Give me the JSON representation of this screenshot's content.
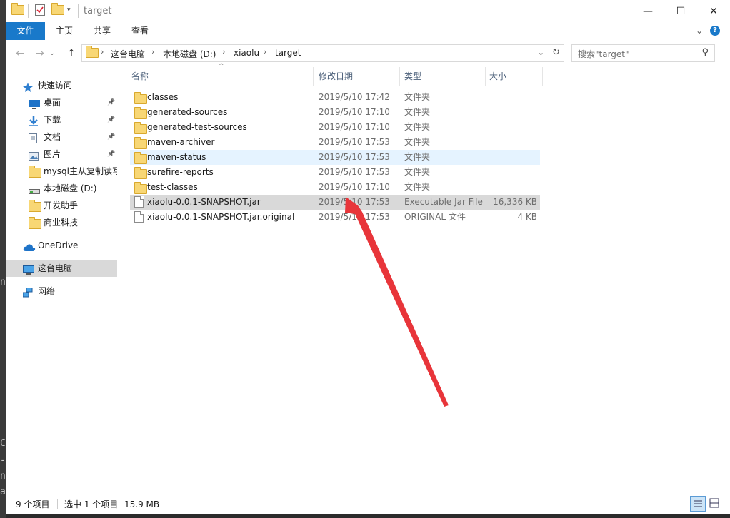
{
  "window": {
    "title": "target",
    "controls": {
      "minimize": "—",
      "maximize": "☐",
      "close": "✕"
    }
  },
  "ribbon": {
    "tabs": [
      "文件",
      "主页",
      "共享",
      "查看"
    ]
  },
  "address": {
    "crumbs": [
      "这台电脑",
      "本地磁盘 (D:)",
      "xiaolu",
      "target"
    ]
  },
  "search": {
    "placeholder": "搜索\"target\""
  },
  "sidebar": {
    "items": [
      {
        "label": "快速访问",
        "icon": "star-icon",
        "pinned": false
      },
      {
        "label": "桌面",
        "icon": "desktop-icon",
        "pinned": true
      },
      {
        "label": "下载",
        "icon": "download-icon",
        "pinned": true
      },
      {
        "label": "文档",
        "icon": "document-icon",
        "pinned": true
      },
      {
        "label": "图片",
        "icon": "pictures-icon",
        "pinned": true
      },
      {
        "label": "mysql主从复制读写",
        "icon": "folder-icon",
        "pinned": false
      },
      {
        "label": "本地磁盘 (D:)",
        "icon": "drive-icon",
        "pinned": false
      },
      {
        "label": "开发助手",
        "icon": "folder-icon",
        "pinned": false
      },
      {
        "label": "商业科技",
        "icon": "folder-icon",
        "pinned": false
      },
      {
        "label": "OneDrive",
        "icon": "cloud-icon",
        "pinned": false
      },
      {
        "label": "这台电脑",
        "icon": "computer-icon",
        "pinned": false
      },
      {
        "label": "网络",
        "icon": "network-icon",
        "pinned": false
      }
    ]
  },
  "columns": {
    "name": "名称",
    "date": "修改日期",
    "type": "类型",
    "size": "大小"
  },
  "files": [
    {
      "name": "classes",
      "date": "2019/5/10 17:42",
      "type": "文件夹",
      "size": "",
      "kind": "folder"
    },
    {
      "name": "generated-sources",
      "date": "2019/5/10 17:10",
      "type": "文件夹",
      "size": "",
      "kind": "folder"
    },
    {
      "name": "generated-test-sources",
      "date": "2019/5/10 17:10",
      "type": "文件夹",
      "size": "",
      "kind": "folder"
    },
    {
      "name": "maven-archiver",
      "date": "2019/5/10 17:53",
      "type": "文件夹",
      "size": "",
      "kind": "folder"
    },
    {
      "name": "maven-status",
      "date": "2019/5/10 17:53",
      "type": "文件夹",
      "size": "",
      "kind": "folder"
    },
    {
      "name": "surefire-reports",
      "date": "2019/5/10 17:53",
      "type": "文件夹",
      "size": "",
      "kind": "folder"
    },
    {
      "name": "test-classes",
      "date": "2019/5/10 17:10",
      "type": "文件夹",
      "size": "",
      "kind": "folder"
    },
    {
      "name": "xiaolu-0.0.1-SNAPSHOT.jar",
      "date": "2019/5/10 17:53",
      "type": "Executable Jar File",
      "size": "16,336 KB",
      "kind": "file"
    },
    {
      "name": "xiaolu-0.0.1-SNAPSHOT.jar.original",
      "date": "2019/5/10 17:53",
      "type": "ORIGINAL 文件",
      "size": "4 KB",
      "kind": "file"
    }
  ],
  "status": {
    "count": "9 个项目",
    "selected": "选中 1 个项目",
    "size": "15.9 MB"
  },
  "background_text": [
    "C(",
    "--",
    "ne",
    " a",
    "ng"
  ],
  "colors": {
    "accent": "#1979ca",
    "arrow": "#e8353a",
    "selection": "#d9d9d9",
    "hover": "#e5f3ff"
  }
}
